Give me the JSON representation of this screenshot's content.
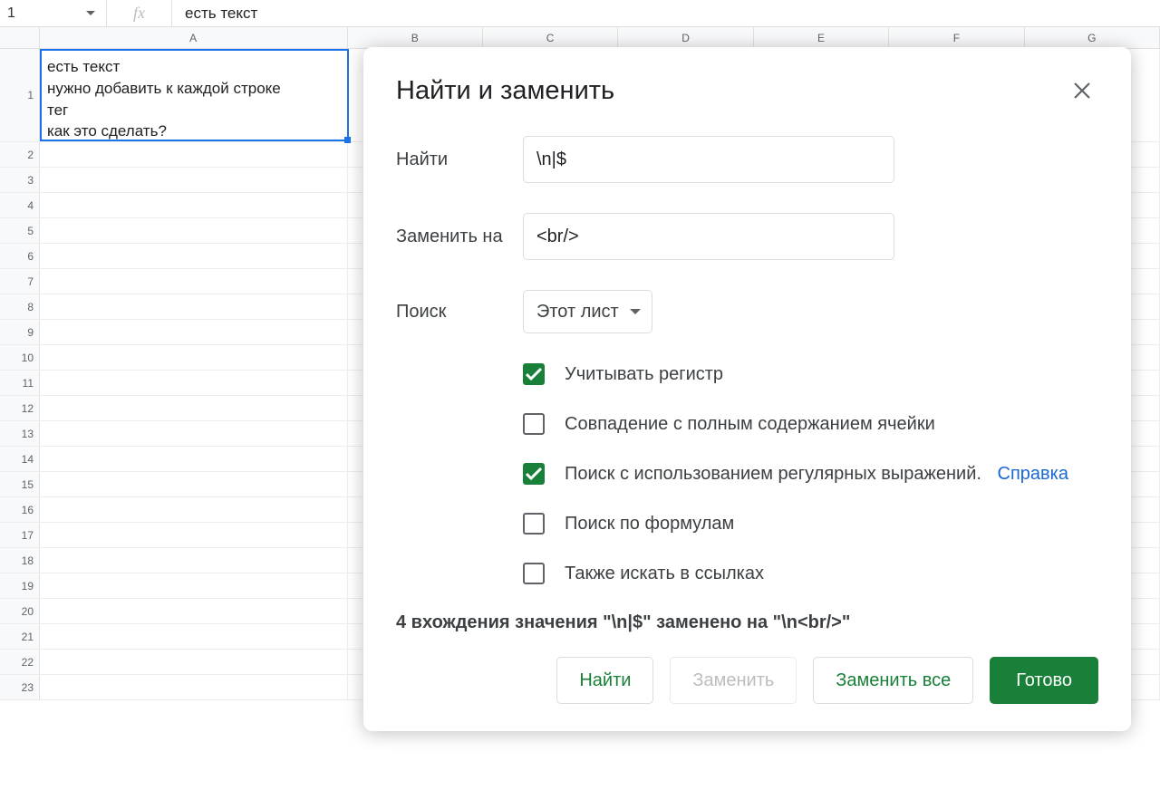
{
  "formula_bar": {
    "name_box": "1",
    "fx_label": "fx",
    "value": "есть текст"
  },
  "columns": [
    "A",
    "B",
    "C",
    "D",
    "E",
    "F",
    "G"
  ],
  "rows": [
    "1",
    "2",
    "3",
    "4",
    "5",
    "6",
    "7",
    "8",
    "9",
    "10",
    "11",
    "12",
    "13",
    "14",
    "15",
    "16",
    "17",
    "18",
    "19",
    "20",
    "21",
    "22",
    "23"
  ],
  "cell_a1": "есть текст\nнужно добавить к каждой строке\nтег\nкак это сделать?",
  "dialog": {
    "title": "Найти и заменить",
    "find_label": "Найти",
    "find_value": "\\n|$",
    "replace_label": "Заменить на",
    "replace_value": "<br/>",
    "search_label": "Поиск",
    "search_scope": "Этот лист",
    "checkboxes": {
      "match_case": {
        "label": "Учитывать регистр",
        "checked": true
      },
      "match_entire": {
        "label": "Совпадение с полным содержанием ячейки",
        "checked": false
      },
      "regex": {
        "label": "Поиск с использованием регулярных выражений.",
        "checked": true,
        "help": "Справка"
      },
      "formulas": {
        "label": "Поиск по формулам",
        "checked": false
      },
      "links": {
        "label": "Также искать в ссылках",
        "checked": false
      }
    },
    "status": "4 вхождения значения \"\\n|$\" заменено на \"\\n<br/>\"",
    "buttons": {
      "find": "Найти",
      "replace": "Заменить",
      "replace_all": "Заменить все",
      "done": "Готово"
    }
  }
}
